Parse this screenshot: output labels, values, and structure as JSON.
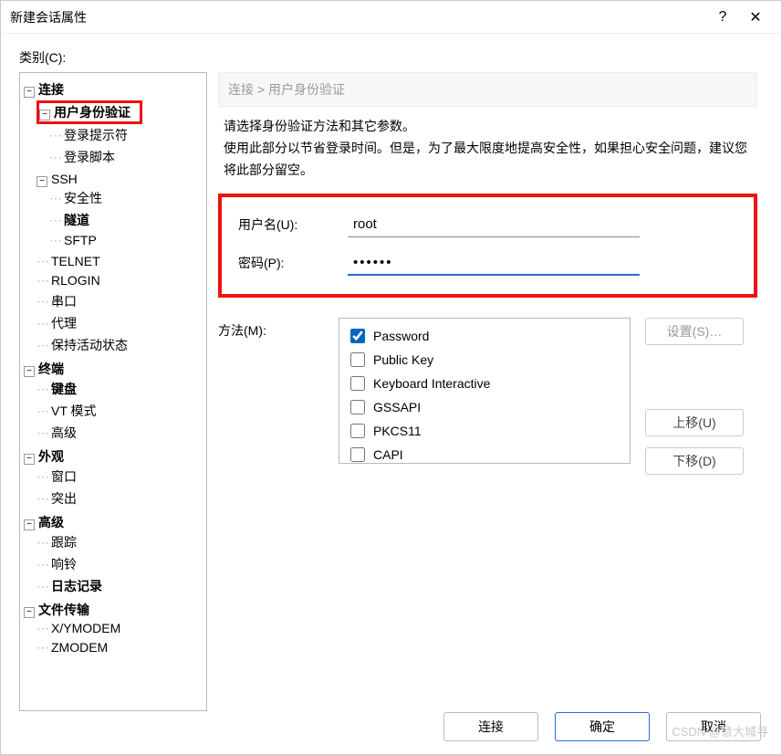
{
  "title": "新建会话属性",
  "help_btn": "?",
  "close_btn": "✕",
  "category_label": "类别(C):",
  "tree": {
    "connection": "连接",
    "user_auth": "用户身份验证",
    "login_prompt": "登录提示符",
    "login_script": "登录脚本",
    "ssh": "SSH",
    "security": "安全性",
    "tunnel": "隧道",
    "sftp": "SFTP",
    "telnet": "TELNET",
    "rlogin": "RLOGIN",
    "serial": "串口",
    "proxy": "代理",
    "keepalive": "保持活动状态",
    "terminal": "终端",
    "keyboard": "键盘",
    "vtmode": "VT 模式",
    "advanced_t": "高级",
    "appearance": "外观",
    "window": "窗口",
    "highlight": "突出",
    "advanced": "高级",
    "trace": "跟踪",
    "bell": "响铃",
    "logging": "日志记录",
    "filetransfer": "文件传输",
    "xymodem": "X/YMODEM",
    "zmodem": "ZMODEM"
  },
  "breadcrumb": "连接 > 用户身份验证",
  "desc_line1": "请选择身份验证方法和其它参数。",
  "desc_line2": "使用此部分以节省登录时间。但是，为了最大限度地提高安全性，如果担心安全问题，建议您将此部分留空。",
  "username_label": "用户名(U):",
  "username_value": "root",
  "password_label": "密码(P):",
  "password_value": "••••••",
  "method_label": "方法(M):",
  "methods": {
    "password": {
      "label": "Password",
      "checked": true
    },
    "publickey": {
      "label": "Public Key",
      "checked": false
    },
    "keyboard": {
      "label": "Keyboard Interactive",
      "checked": false
    },
    "gssapi": {
      "label": "GSSAPI",
      "checked": false
    },
    "pkcs11": {
      "label": "PKCS11",
      "checked": false
    },
    "capi": {
      "label": "CAPI",
      "checked": false
    }
  },
  "settings_btn": "设置(S)…",
  "moveup_btn": "上移(U)",
  "movedown_btn": "下移(D)",
  "connect_btn": "连接",
  "ok_btn": "确定",
  "cancel_btn": "取消",
  "watermark": "CSDN @意大城寻"
}
